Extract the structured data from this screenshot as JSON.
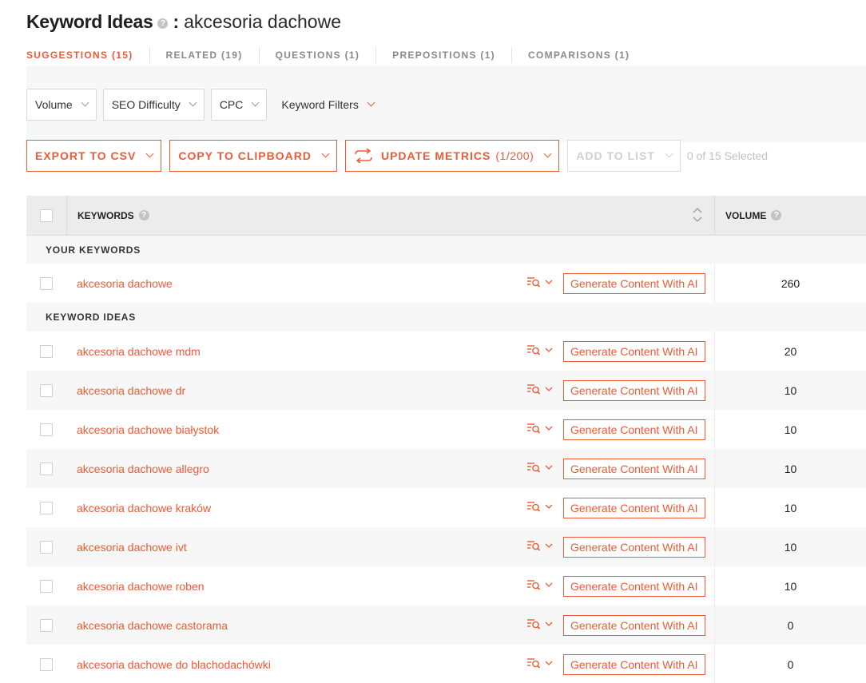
{
  "header": {
    "title": "Keyword Ideas",
    "help": "?",
    "colon": ":",
    "query": "akcesoria dachowe"
  },
  "tabs": [
    {
      "label": "SUGGESTIONS (15)",
      "active": true
    },
    {
      "label": "RELATED (19)",
      "active": false
    },
    {
      "label": "QUESTIONS (1)",
      "active": false
    },
    {
      "label": "PREPOSITIONS (1)",
      "active": false
    },
    {
      "label": "COMPARISONS (1)",
      "active": false
    }
  ],
  "filters": {
    "volume": "Volume",
    "seo_difficulty": "SEO Difficulty",
    "cpc": "CPC",
    "keyword_filters": "Keyword Filters"
  },
  "actions": {
    "export": "EXPORT TO CSV",
    "copy": "COPY TO CLIPBOARD",
    "update": "UPDATE METRICS",
    "update_count": "(1/200)",
    "add_to_list": "ADD TO LIST",
    "selected": "0 of 15 Selected"
  },
  "table": {
    "col_keywords": "KEYWORDS",
    "col_volume": "VOLUME",
    "help": "?",
    "group_your": "YOUR KEYWORDS",
    "group_ideas": "KEYWORD IDEAS",
    "generate_label": "Generate Content With AI",
    "your_keywords": [
      {
        "keyword": "akcesoria dachowe",
        "volume": "260"
      }
    ],
    "keyword_ideas": [
      {
        "keyword": "akcesoria dachowe mdm",
        "volume": "20"
      },
      {
        "keyword": "akcesoria dachowe dr",
        "volume": "10"
      },
      {
        "keyword": "akcesoria dachowe białystok",
        "volume": "10"
      },
      {
        "keyword": "akcesoria dachowe allegro",
        "volume": "10"
      },
      {
        "keyword": "akcesoria dachowe kraków",
        "volume": "10"
      },
      {
        "keyword": "akcesoria dachowe ivt",
        "volume": "10"
      },
      {
        "keyword": "akcesoria dachowe roben",
        "volume": "10"
      },
      {
        "keyword": "akcesoria dachowe castorama",
        "volume": "0"
      },
      {
        "keyword": "akcesoria dachowe do blachodachówki",
        "volume": "0"
      }
    ]
  },
  "colors": {
    "accent": "#eb5b36",
    "band": "#f7f7f7",
    "header_bg": "#ececec"
  }
}
